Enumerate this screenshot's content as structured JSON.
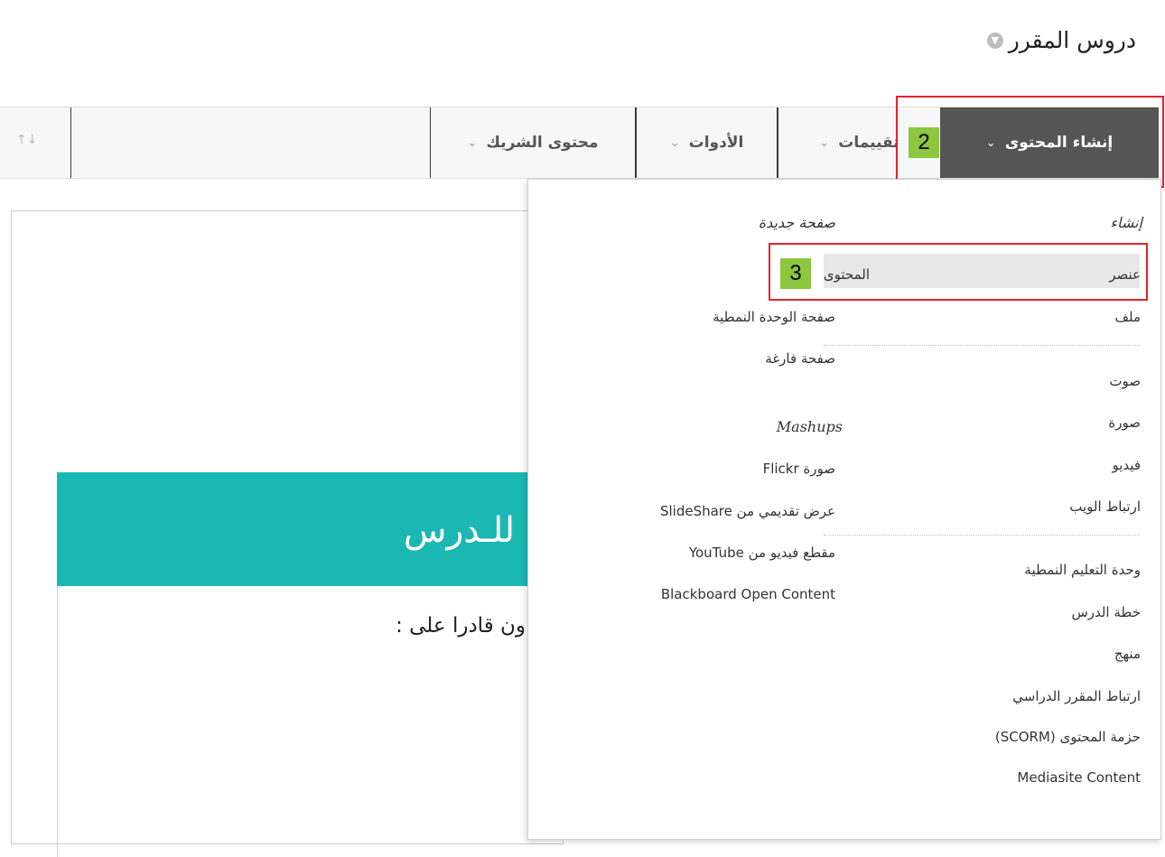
{
  "page": {
    "title": "دروس المقرر"
  },
  "action_bar": {
    "create_content": "إنشاء المحتوى",
    "assessments": "تقييمات",
    "tools": "الأدوات",
    "partner_content": "محتوى الشريك"
  },
  "badges": {
    "step2": "2",
    "step3": "3"
  },
  "create_menu": {
    "create_heading": "إنشاء",
    "new_page_heading": "صفحة جديدة",
    "create_items": [
      "عنصر",
      "ملف",
      "صوت",
      "صورة",
      "فيديو",
      "ارتباط الويب",
      "وحدة التعليم النمطية",
      "خطة الدرس",
      "منهج",
      "ارتباط المقرر الدراسي",
      "حزمة المحتوى (SCORM)",
      "Mediasite Content"
    ],
    "new_page_items": [
      "المحتوى",
      "صفحة الوحدة النمطية",
      "صفحة فارغة"
    ],
    "mashups_heading": "Mashups",
    "mashup_items": [
      "صورة Flickr",
      "عرض تقديمي من SlideShare",
      "مقطع فيديو من YouTube",
      "Blackboard Open Content"
    ]
  },
  "content": {
    "banner_text": "للـدرس",
    "body_text": "ون قادرا على :"
  },
  "colors": {
    "create_bg": "#555555",
    "banner": "#1bb8b3",
    "highlight": "#e5212d",
    "badge": "#8dc63f"
  }
}
